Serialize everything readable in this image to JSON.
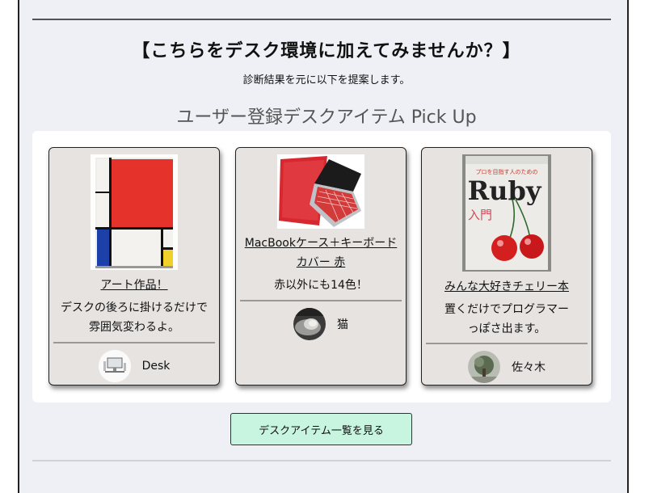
{
  "heading": "【こちらをデスク環境に加えてみませんか？】",
  "subheading": "診断結果を元に以下を提案します。",
  "section_title": "ユーザー登録デスクアイテム Pick Up",
  "items": [
    {
      "title": "アート作品！",
      "description": "デスクの後ろに掛けるだけで雰囲気変わるよ。",
      "owner": "Desk"
    },
    {
      "title": "MacBookケース＋キーボードカバー 赤",
      "description": "赤以外にも14色！",
      "owner": "猫"
    },
    {
      "title": "みんな大好きチェリー本",
      "description": "置くだけでプログラマーっぽさ出ます。",
      "owner": "佐々木"
    }
  ],
  "book_cover": {
    "title": "Ruby",
    "subtitle": "入門",
    "banner": "プロを目指す人のための"
  },
  "cta_label": "デスクアイテム一覧を見る"
}
